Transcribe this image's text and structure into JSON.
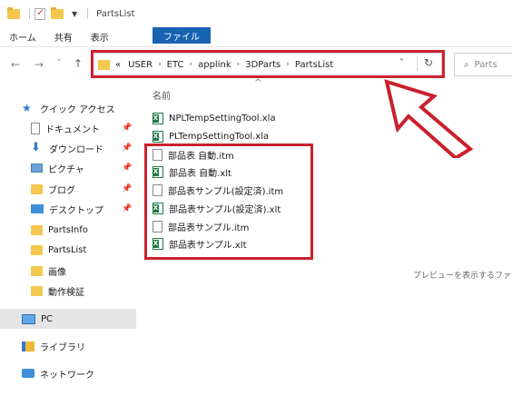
{
  "window": {
    "title": "PartsList"
  },
  "ribbon": {
    "tabs": [
      "ファイル",
      "ホーム",
      "共有",
      "表示"
    ]
  },
  "address": {
    "prefix": "«",
    "crumbs": [
      "USER",
      "ETC",
      "applink",
      "3DParts",
      "PartsList"
    ],
    "separator": "›"
  },
  "search": {
    "placeholder": "Parts"
  },
  "nav": {
    "items": [
      {
        "label": "クイック アクセス",
        "icon": "star-icon"
      },
      {
        "label": "ドキュメント",
        "icon": "document-icon",
        "pinned": true
      },
      {
        "label": "ダウンロード",
        "icon": "download-icon",
        "pinned": true
      },
      {
        "label": "ピクチャ",
        "icon": "pictures-icon",
        "pinned": true
      },
      {
        "label": "ブログ",
        "icon": "folder-icon",
        "pinned": true
      },
      {
        "label": "デスクトップ",
        "icon": "desktop-icon",
        "pinned": true
      },
      {
        "label": "PartsInfo",
        "icon": "folder-icon"
      },
      {
        "label": "PartsList",
        "icon": "folder-icon"
      },
      {
        "label": "画像",
        "icon": "folder-icon"
      },
      {
        "label": "動作検証",
        "icon": "folder-icon"
      },
      {
        "label": "PC",
        "icon": "pc-icon",
        "selected": true
      },
      {
        "label": "ライブラリ",
        "icon": "library-icon"
      },
      {
        "label": "ネットワーク",
        "icon": "network-icon"
      }
    ],
    "pin_glyph": "📌"
  },
  "content": {
    "column_header": "名前",
    "sort_glyph": "^",
    "files": [
      {
        "name": "NPLTempSettingTool.xla",
        "type": "excel"
      },
      {
        "name": "PLTempSettingTool.xla",
        "type": "excel"
      },
      {
        "name": "部品表 自動.itm",
        "type": "text"
      },
      {
        "name": "部品表 自動.xlt",
        "type": "excel"
      },
      {
        "name": "部品表サンプル(設定済).itm",
        "type": "text"
      },
      {
        "name": "部品表サンプル(設定済).xlt",
        "type": "excel"
      },
      {
        "name": "部品表サンプル.itm",
        "type": "text"
      },
      {
        "name": "部品表サンプル.xlt",
        "type": "excel"
      }
    ],
    "preview_text": "プレビューを表示するファイ"
  },
  "colors": {
    "highlight": "#c9212d",
    "file_tab": "#1a63b3",
    "folder": "#f4c74e"
  }
}
